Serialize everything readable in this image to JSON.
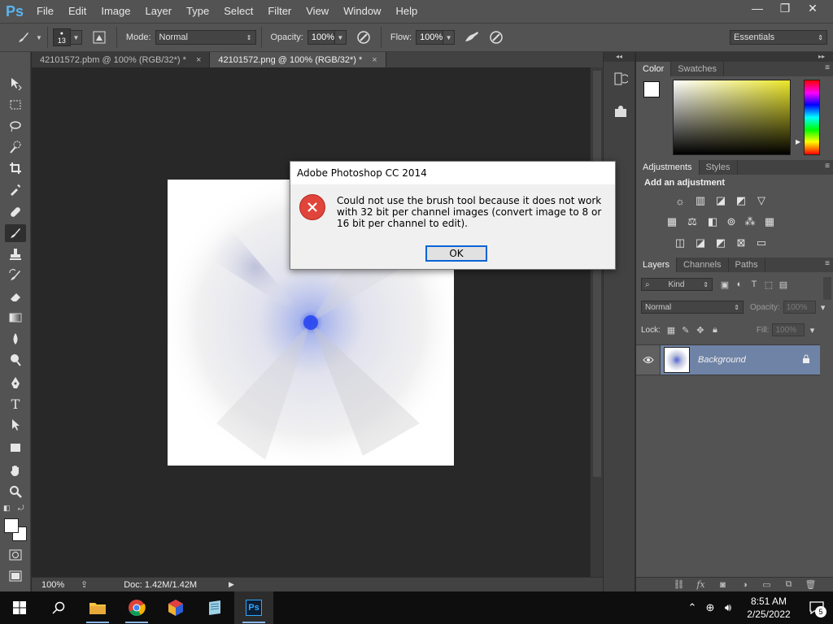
{
  "app": {
    "logo": "Ps",
    "menus": [
      "File",
      "Edit",
      "Image",
      "Layer",
      "Type",
      "Select",
      "Filter",
      "View",
      "Window",
      "Help"
    ],
    "window_controls": {
      "minimize": "—",
      "restore": "❐",
      "close": "✕"
    }
  },
  "options_bar": {
    "brush_size": "13",
    "mode_label": "Mode:",
    "mode_value": "Normal",
    "opacity_label": "Opacity:",
    "opacity_value": "100%",
    "flow_label": "Flow:",
    "flow_value": "100%",
    "workspace": "Essentials"
  },
  "documents": {
    "tabs": [
      {
        "label": "42101572.pbm @ 100% (RGB/32*) *",
        "active": false
      },
      {
        "label": "42101572.png @ 100% (RGB/32*) *",
        "active": true
      }
    ],
    "close_glyph": "×"
  },
  "status_bar": {
    "zoom": "100%",
    "doc_size": "Doc: 1.42M/1.42M"
  },
  "panels": {
    "color": {
      "tabs": [
        "Color",
        "Swatches"
      ]
    },
    "adjustments": {
      "tabs": [
        "Adjustments",
        "Styles"
      ],
      "title": "Add an adjustment"
    },
    "layers": {
      "tabs": [
        "Layers",
        "Channels",
        "Paths"
      ],
      "kind_filter": "Kind",
      "blend_mode": "Normal",
      "opacity_label": "Opacity:",
      "opacity_value": "100%",
      "lock_label": "Lock:",
      "fill_label": "Fill:",
      "fill_value": "100%",
      "layer_name": "Background"
    }
  },
  "dialog": {
    "title": "Adobe Photoshop CC 2014",
    "message": "Could not use the brush tool because it does not work with 32 bit per channel images (convert image to 8 or 16 bit per channel to edit).",
    "ok_label": "OK",
    "icon": "error-icon"
  },
  "taskbar": {
    "time": "8:51 AM",
    "date": "2/25/2022",
    "notification_count": "5"
  },
  "colors": {
    "ps_blue": "#5ab4f0",
    "ui_gray": "#535353",
    "canvas_bg": "#282828",
    "error_red": "#e0443a",
    "selected_layer": "#6f83a6"
  }
}
